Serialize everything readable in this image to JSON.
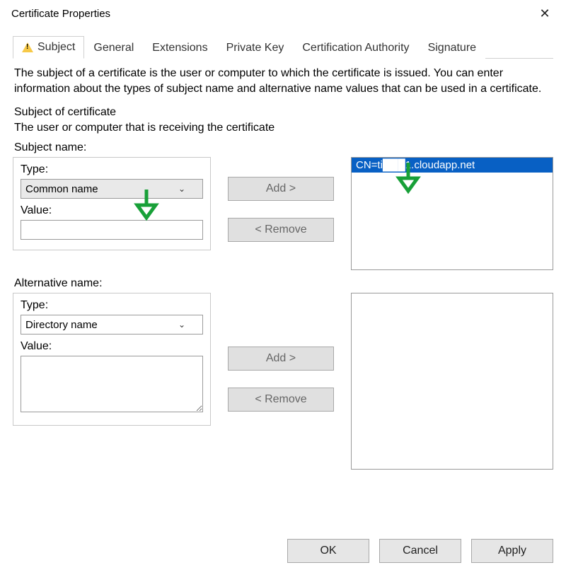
{
  "window": {
    "title": "Certificate Properties"
  },
  "tabs": {
    "subject": "Subject",
    "general": "General",
    "extensions": "Extensions",
    "private_key": "Private Key",
    "cert_authority": "Certification Authority",
    "signature": "Signature"
  },
  "page": {
    "description": "The subject of a certificate is the user or computer to which the certificate is issued. You can enter information about the types of subject name and alternative name values that can be used in a certificate.",
    "section_heading": "Subject of certificate",
    "section_hint": "The user or computer that is receiving the certificate"
  },
  "subject_name": {
    "group_label": "Subject name:",
    "type_label": "Type:",
    "type_value": "Common name",
    "value_label": "Value:",
    "value_value": "",
    "add_label": "Add >",
    "remove_label": "< Remove",
    "list_items": [
      "CN=ti███1.cloudapp.net"
    ]
  },
  "alt_name": {
    "group_label": "Alternative name:",
    "type_label": "Type:",
    "type_value": "Directory name",
    "value_label": "Value:",
    "value_value": "",
    "add_label": "Add >",
    "remove_label": "< Remove",
    "list_items": []
  },
  "footer": {
    "ok": "OK",
    "cancel": "Cancel",
    "apply": "Apply"
  },
  "annotations": {
    "arrow_color": "#18a038"
  }
}
